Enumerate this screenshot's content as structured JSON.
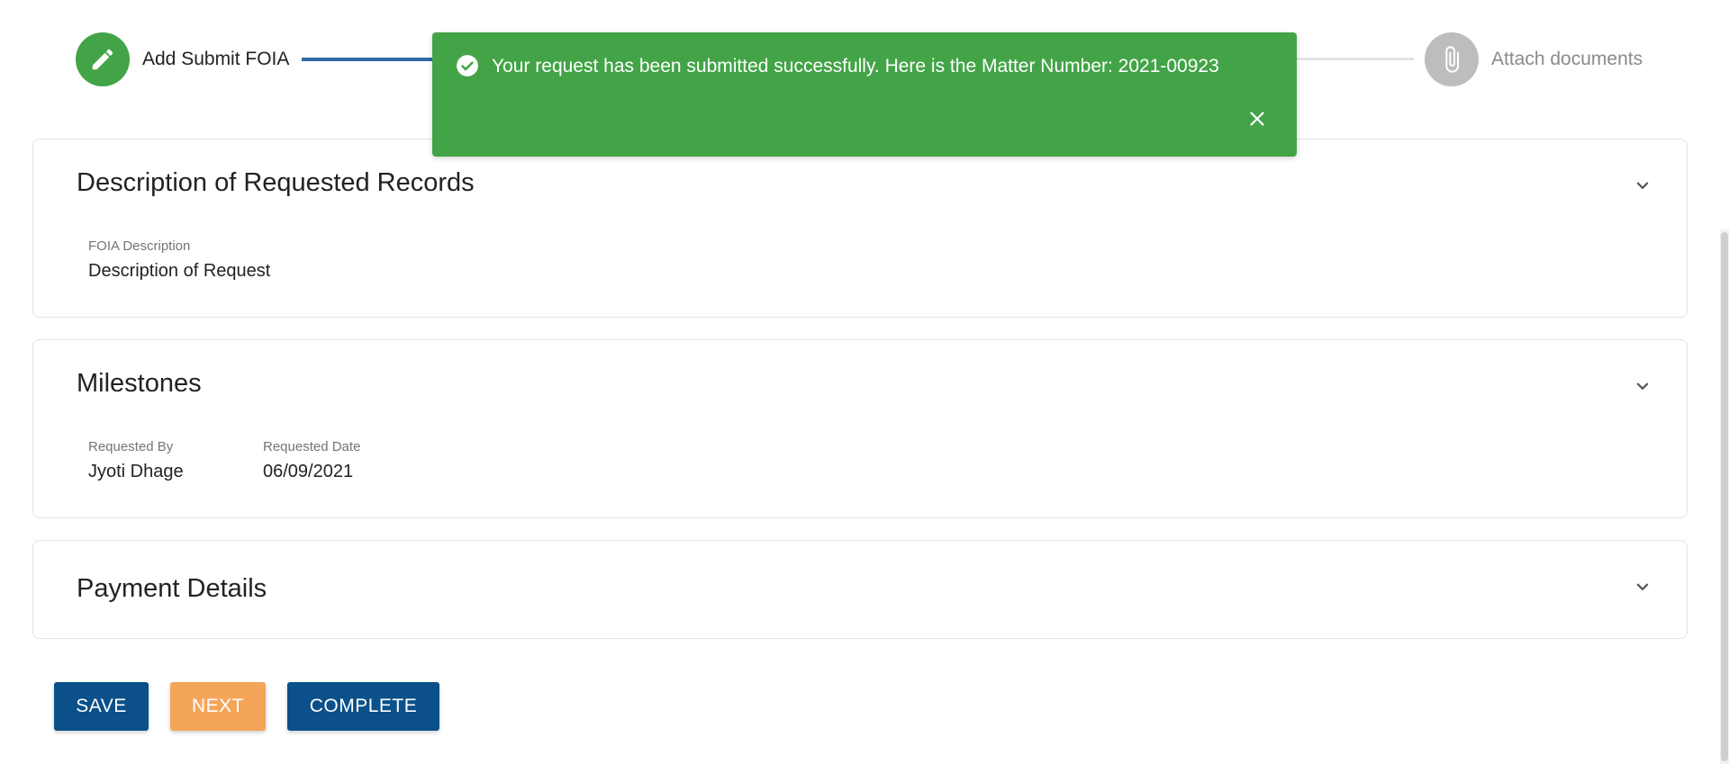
{
  "stepper": {
    "steps": [
      {
        "label": "Add Submit FOIA",
        "icon": "pencil-icon",
        "state": "active"
      },
      {
        "label": "Attach documents",
        "icon": "paperclip-icon",
        "state": "inactive"
      }
    ]
  },
  "toast": {
    "message": "Your request has been submitted successfully. Here is the Matter Number: 2021-00923",
    "icon": "check-circle-icon",
    "close_icon": "close-icon",
    "color": "#43a447"
  },
  "sections": {
    "description": {
      "title": "Description of Requested Records",
      "fields": [
        {
          "label": "FOIA Description",
          "value": "Description of Request"
        }
      ]
    },
    "milestones": {
      "title": "Milestones",
      "fields": [
        {
          "label": "Requested By",
          "value": "Jyoti Dhage"
        },
        {
          "label": "Requested Date",
          "value": "06/09/2021"
        }
      ]
    },
    "payment": {
      "title": "Payment Details"
    }
  },
  "actions": {
    "save_label": "SAVE",
    "next_label": "NEXT",
    "complete_label": "COMPLETE"
  },
  "colors": {
    "primary": "#0b5089",
    "accent": "#f5a55a",
    "success": "#43a447"
  }
}
